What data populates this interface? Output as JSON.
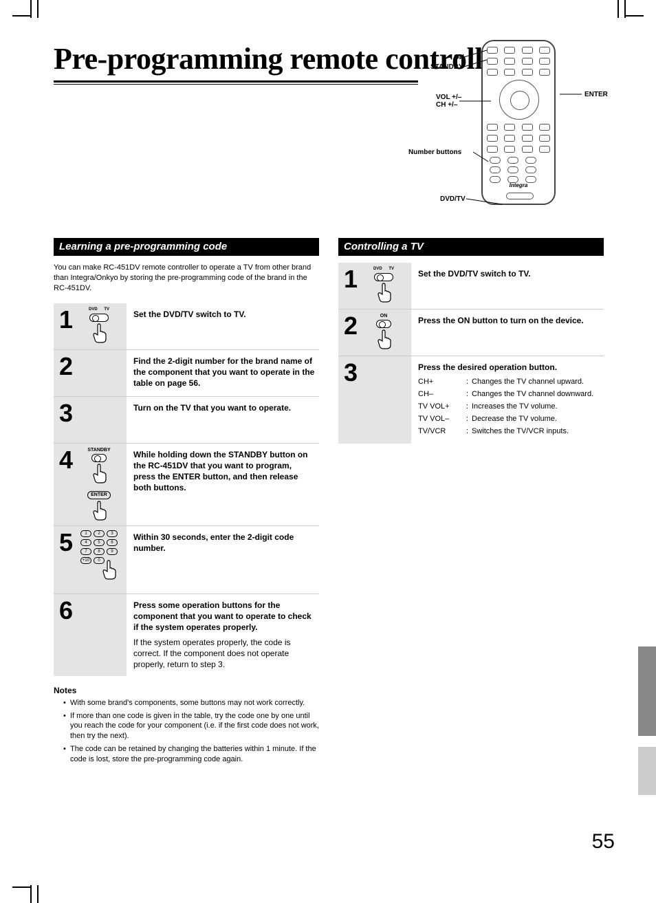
{
  "page_number": "55",
  "title": "Pre-programming remote controller",
  "remote": {
    "labels": {
      "on": "ON",
      "standby": "STANDBY",
      "vol_ch": "VOL +/–\nCH +/–",
      "numbers": "Number buttons",
      "dvd_tv": "DVD/TV",
      "enter": "ENTER"
    },
    "brand": "Integra"
  },
  "left": {
    "heading": "Learning a pre-programming code",
    "intro": "You can make RC-451DV remote controller to operate a TV from other brand than Integra/Onkyo by storing the pre-programming code of the brand in the RC-451DV.",
    "steps": [
      {
        "n": "1",
        "title": "Set the DVD/TV switch to TV.",
        "icon": "switch"
      },
      {
        "n": "2",
        "title": "Find the 2-digit number for the brand name of the component that you want to operate in the table on page 56.",
        "icon": ""
      },
      {
        "n": "3",
        "title": "Turn on the TV that you want to operate.",
        "icon": ""
      },
      {
        "n": "4",
        "title": "While holding down the STANDBY button on the RC-451DV that you want to program, press the ENTER button, and then release both buttons.",
        "icon": "standby_enter"
      },
      {
        "n": "5",
        "title": "Within 30 seconds, enter the 2-digit code number.",
        "icon": "numpad"
      },
      {
        "n": "6",
        "title": "Press some operation buttons for the component that you want to operate to check if the system operates properly.",
        "sub": "If the system operates properly, the code is correct. If the component does not operate properly, return to step 3.",
        "icon": ""
      }
    ],
    "notes_head": "Notes",
    "notes": [
      "With some brand's components, some buttons may not work correctly.",
      "If more than one code is given in the table, try the code one by one until you reach the code for your component (i.e. if the first code does not work, then try the next).",
      "The code can be retained by changing the batteries within 1 minute. If the code is lost, store the pre-programming code again."
    ]
  },
  "right": {
    "heading": "Controlling a TV",
    "steps": [
      {
        "n": "1",
        "title": "Set the DVD/TV switch to TV.",
        "icon": "switch"
      },
      {
        "n": "2",
        "title": "Press the ON button to turn on the device.",
        "icon": "on"
      },
      {
        "n": "3",
        "title": "Press the desired operation button.",
        "icon": "",
        "ops": [
          {
            "k": "CH+",
            "v": "Changes the TV channel upward."
          },
          {
            "k": "CH–",
            "v": "Changes the TV channel downward."
          },
          {
            "k": "TV VOL+",
            "v": "Increases the TV volume."
          },
          {
            "k": "TV VOL–",
            "v": "Decrease the TV volume."
          },
          {
            "k": "TV/VCR",
            "v": "Switches the TV/VCR inputs."
          }
        ]
      }
    ]
  },
  "icon_text": {
    "dvd": "DVD",
    "tv": "TV",
    "standby": "STANDBY",
    "on": "ON",
    "enter": "ENTER"
  }
}
